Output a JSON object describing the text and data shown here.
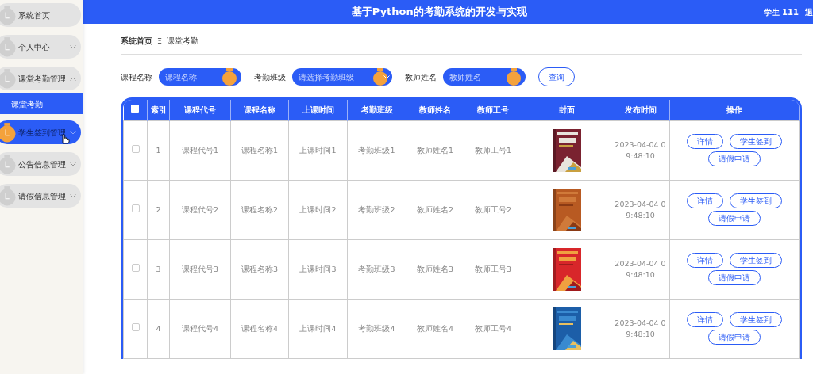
{
  "header": {
    "title": "基于Python的考勤系统的开发与实现",
    "user": "学生 111",
    "logout": "退"
  },
  "sidebar": {
    "items": [
      {
        "label": "系统首页",
        "selected": false,
        "hovered": false
      },
      {
        "label": "个人中心",
        "selected": false,
        "hovered": false,
        "expanded": false
      },
      {
        "label": "课堂考勤管理",
        "selected": false,
        "hovered": false,
        "expanded": true,
        "children": [
          {
            "label": "课堂考勤",
            "selected": true
          }
        ]
      },
      {
        "label": "学生签到管理",
        "selected": false,
        "hovered": true,
        "expanded": false
      },
      {
        "label": "公告信息管理",
        "selected": false,
        "hovered": false,
        "expanded": false
      },
      {
        "label": "请假信息管理",
        "selected": false,
        "hovered": false,
        "expanded": false
      }
    ]
  },
  "breadcrumb": {
    "items": [
      "系统首页",
      "课堂考勤"
    ],
    "separator": "Ξ"
  },
  "search": {
    "fields": [
      {
        "label": "课程名称",
        "placeholder": "课程名称",
        "kind": "text"
      },
      {
        "label": "考勤班级",
        "placeholder": "请选择考勤班级",
        "kind": "select"
      },
      {
        "label": "教师姓名",
        "placeholder": "教师姓名",
        "kind": "text"
      }
    ],
    "button": "查询"
  },
  "table": {
    "header_checkbox": {
      "checked": false
    },
    "columns": [
      "索引",
      "课程代号",
      "课程名称",
      "上课时间",
      "考勤班级",
      "教师姓名",
      "教师工号",
      "封面",
      "发布时间",
      "操作"
    ],
    "rows": [
      {
        "checked": false,
        "cells": [
          "1",
          "课程代号1",
          "课程名称1",
          "上课时间1",
          "考勤班级1",
          "教师姓名1",
          "教师工号1"
        ],
        "cover": {
          "kind": "picture"
        },
        "publish_time": "2023-04-04 09:48:10",
        "actions": [
          "详情",
          "学生签到",
          "请假申请"
        ]
      },
      {
        "checked": false,
        "cells": [
          "2",
          "课程代号2",
          "课程名称2",
          "上课时间2",
          "考勤班级2",
          "教师姓名2",
          "教师工号2"
        ],
        "cover": {
          "kind": "picture"
        },
        "publish_time": "2023-04-04 09:48:10",
        "actions": [
          "详情",
          "学生签到",
          "请假申请"
        ]
      },
      {
        "checked": false,
        "cells": [
          "3",
          "课程代号3",
          "课程名称3",
          "上课时间3",
          "考勤班级3",
          "教师姓名3",
          "教师工号3"
        ],
        "cover": {
          "kind": "picture"
        },
        "publish_time": "2023-04-04 09:48:10",
        "actions": [
          "详情",
          "学生签到",
          "请假申请"
        ]
      },
      {
        "checked": false,
        "cells": [
          "4",
          "课程代号4",
          "课程名称4",
          "上课时间4",
          "考勤班级4",
          "教师姓名4",
          "教师工号4"
        ],
        "cover": {
          "kind": "picture"
        },
        "publish_time": "2023-04-04 09:48:10",
        "actions": [
          "详情",
          "学生签到",
          "请假申请"
        ]
      }
    ]
  }
}
